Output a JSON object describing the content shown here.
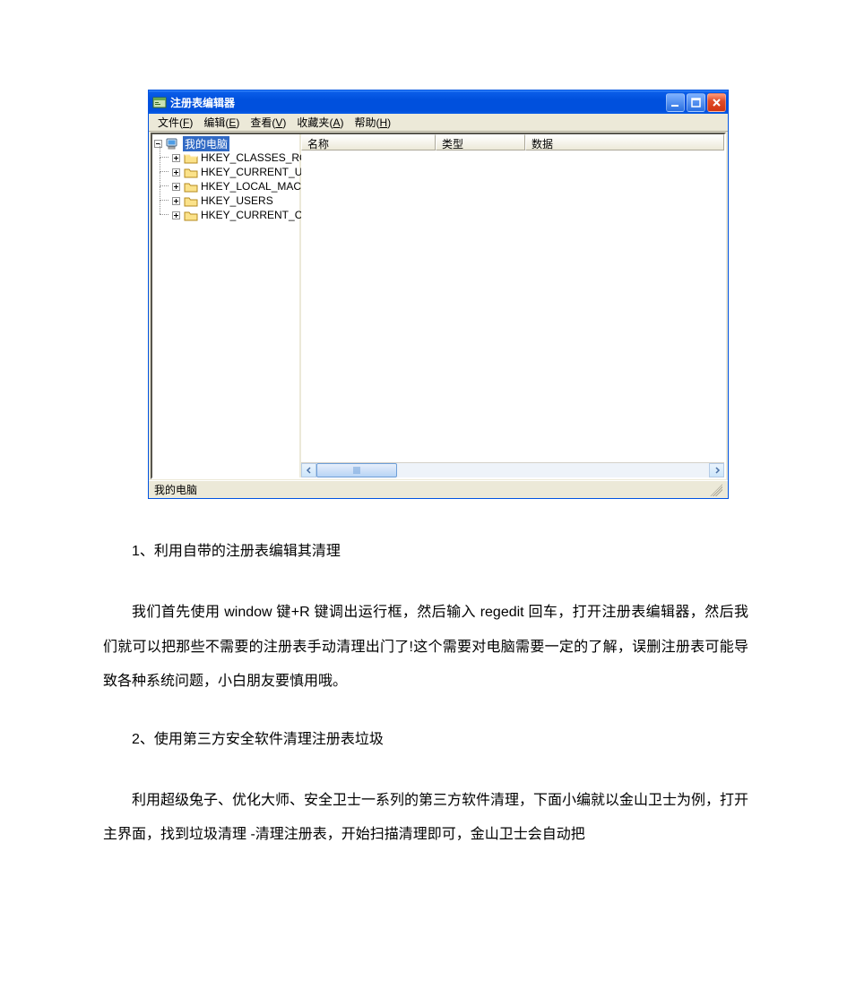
{
  "window": {
    "title": "注册表编辑器",
    "menu": [
      {
        "label": "文件",
        "hotkey": "F"
      },
      {
        "label": "编辑",
        "hotkey": "E"
      },
      {
        "label": "查看",
        "hotkey": "V"
      },
      {
        "label": "收藏夹",
        "hotkey": "A"
      },
      {
        "label": "帮助",
        "hotkey": "H"
      }
    ],
    "tree": {
      "root": {
        "label": "我的电脑"
      },
      "keys": [
        "HKEY_CLASSES_ROOT",
        "HKEY_CURRENT_USER",
        "HKEY_LOCAL_MACHINE",
        "HKEY_USERS",
        "HKEY_CURRENT_CONFIG"
      ]
    },
    "list_columns": [
      "名称",
      "类型",
      "数据"
    ],
    "status": "我的电脑"
  },
  "doc": {
    "h1": "1、利用自带的注册表编辑其清理",
    "p1": "我们首先使用 window 键+R 键调出运行框，然后输入 regedit 回车，打开注册表编辑器，然后我们就可以把那些不需要的注册表手动清理出门了!这个需要对电脑需要一定的了解，误删注册表可能导致各种系统问题，小白朋友要慎用哦。",
    "h2": "2、使用第三方安全软件清理注册表垃圾",
    "p2": "利用超级兔子、优化大师、安全卫士一系列的第三方软件清理，下面小编就以金山卫士为例，打开主界面，找到垃圾清理 -清理注册表，开始扫描清理即可，金山卫士会自动把"
  }
}
